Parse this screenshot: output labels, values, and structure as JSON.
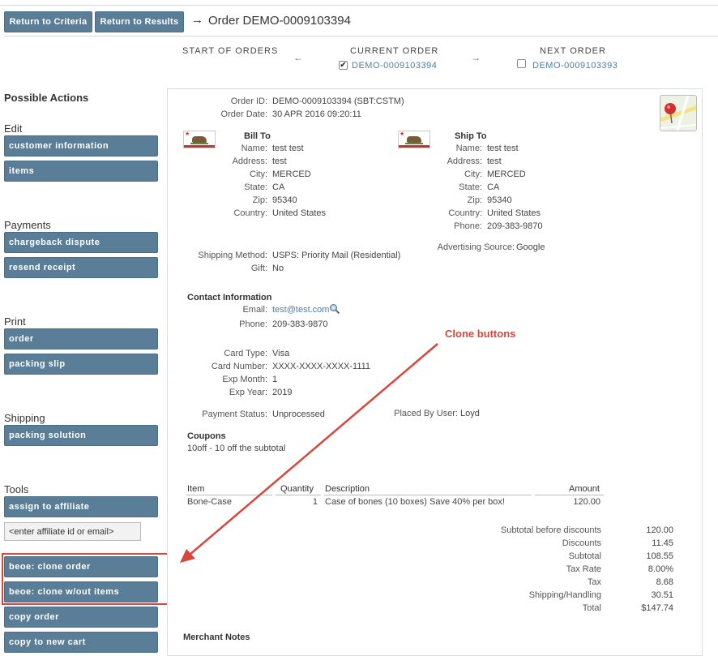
{
  "toolbar": {
    "return_criteria": "Return to Criteria",
    "return_results": "Return to Results",
    "arrow": "→",
    "order_title": "Order DEMO-0009103394"
  },
  "order_nav": {
    "start_label": "START OF ORDERS",
    "current_label": "CURRENT ORDER",
    "current_link": "DEMO-0009103394",
    "current_checked": true,
    "next_label": "NEXT ORDER",
    "next_link": "DEMO-0009103393",
    "next_checked": false,
    "left_arrow": "←",
    "right_arrow": "→"
  },
  "sidebar": {
    "title": "Possible Actions",
    "edit_heading": "Edit",
    "edit_items": [
      "customer information",
      "items"
    ],
    "payments_heading": "Payments",
    "payments_items": [
      "chargeback dispute",
      "resend receipt"
    ],
    "print_heading": "Print",
    "print_items": [
      "order",
      "packing slip"
    ],
    "shipping_heading": "Shipping",
    "shipping_items": [
      "packing solution"
    ],
    "tools_heading": "Tools",
    "tools_items": [
      "assign to affiliate",
      "beoe: clone order",
      "beoe: clone w/out items",
      "copy order",
      "copy to new cart"
    ],
    "affiliate_placeholder": "<enter affiliate id or email>"
  },
  "order": {
    "order_id_label": "Order ID:",
    "order_id": "DEMO-0009103394 (SBT:CSTM)",
    "order_date_label": "Order Date:",
    "order_date": "30 APR 2016 09:20:11",
    "bill_to": {
      "heading": "Bill To",
      "name_label": "Name:",
      "name": "test test",
      "address_label": "Address:",
      "address": "test",
      "city_label": "City:",
      "city": "MERCED",
      "state_label": "State:",
      "state": "CA",
      "zip_label": "Zip:",
      "zip": "95340",
      "country_label": "Country:",
      "country": "United States"
    },
    "ship_to": {
      "heading": "Ship To",
      "name_label": "Name:",
      "name": "test test",
      "address_label": "Address:",
      "address": "test",
      "city_label": "City:",
      "city": "MERCED",
      "state_label": "State:",
      "state": "CA",
      "zip_label": "Zip:",
      "zip": "95340",
      "country_label": "Country:",
      "country": "United States",
      "phone_label": "Phone:",
      "phone": "209-383-9870"
    },
    "flag_text": "CALIFORNIA REPUBLIC",
    "advertising_label": "Advertising Source:",
    "advertising": "Google",
    "shipping_method_label": "Shipping Method:",
    "shipping_method": "USPS: Priority Mail (Residential)",
    "gift_label": "Gift:",
    "gift": "No",
    "contact_heading": "Contact Information",
    "email_label": "Email:",
    "email": "test@test.com",
    "phone_label": "Phone:",
    "phone": "209-383-9870",
    "card_type_label": "Card Type:",
    "card_type": "Visa",
    "card_number_label": "Card Number:",
    "card_number": "XXXX-XXXX-XXXX-1111",
    "exp_month_label": "Exp Month:",
    "exp_month": "1",
    "exp_year_label": "Exp Year:",
    "exp_year": "2019",
    "payment_status_label": "Payment Status:",
    "payment_status": "Unprocessed",
    "placed_by_label": "Placed By User:",
    "placed_by": "Loyd",
    "coupons_heading": "Coupons",
    "coupon": "10off - 10 off the subtotal",
    "merchant_notes_heading": "Merchant Notes"
  },
  "items_table": {
    "headers": [
      "Item",
      "Quantity",
      "Description",
      "Amount"
    ],
    "rows": [
      {
        "item": "Bone-Case",
        "quantity": "1",
        "description": "Case of bones (10 boxes) Save 40% per box!",
        "amount": "120.00"
      }
    ]
  },
  "totals": [
    {
      "label": "Subtotal before discounts",
      "value": "120.00"
    },
    {
      "label": "Discounts",
      "value": "11.45"
    },
    {
      "label": "Subtotal",
      "value": "108.55"
    },
    {
      "label": "Tax Rate",
      "value": "8.00%"
    },
    {
      "label": "Tax",
      "value": "8.68"
    },
    {
      "label": "Shipping/Handling",
      "value": "30.51"
    },
    {
      "label": "Total",
      "value": "$147.74"
    }
  ],
  "annotation": {
    "callout_text": "Clone buttons",
    "color": "#d9463c"
  },
  "colors": {
    "button": "#5a7e98",
    "link": "#4a7fa5"
  }
}
